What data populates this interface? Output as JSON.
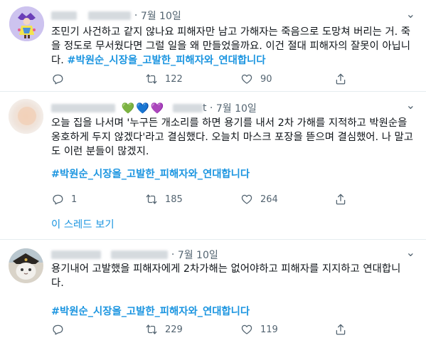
{
  "tweets": [
    {
      "date": "7월 10일",
      "text": "조민기 사건하고 같지 않나요 피해자만 남고 가해자는 죽음으로 도망쳐 버리는 거. 죽을 정도로 무서웠다면 그럴 일을 왜 만들었을까요. 이건 절대 피해자의 잘못이 아닙니다. ",
      "hashtag": "#박원순_시장을_고발한_피해자와_연대합니다",
      "reply_count": "",
      "retweet_count": "122",
      "like_count": "90"
    },
    {
      "date": "7월 10일",
      "name_suffix": "t",
      "hearts": [
        "💚",
        "💙",
        "💜"
      ],
      "text": "오늘 집을 나서며 '누구든 개소리를 하면 용기를 내서 2차 가해를 지적하고 박원순을 옹호하게 두지 않겠다'라고 결심했다. 오늘치 마스크 포장을 뜯으며 결심했어. 나 말고도 이런 분들이 많겠지.",
      "hashtag": "#박원순_시장을_고발한_피해자와_연대합니다",
      "reply_count": "1",
      "retweet_count": "185",
      "like_count": "264",
      "thread_link": "이 스레드 보기"
    },
    {
      "date": "7월 10일",
      "text": "용기내어 고발했을 피해자에게 2차가해는 없어야하고 피해자를 지지하고 연대합니다.",
      "hashtag": "#박원순_시장을_고발한_피해자와_연대합니다",
      "reply_count": "",
      "retweet_count": "229",
      "like_count": "119"
    }
  ],
  "icons": {
    "reply": "reply-icon",
    "retweet": "retweet-icon",
    "like": "heart-icon",
    "share": "share-icon",
    "more": "more-icon"
  },
  "colors": {
    "hashtag": "#1b95e0",
    "muted": "#536471",
    "divider": "#e6ecf0"
  }
}
